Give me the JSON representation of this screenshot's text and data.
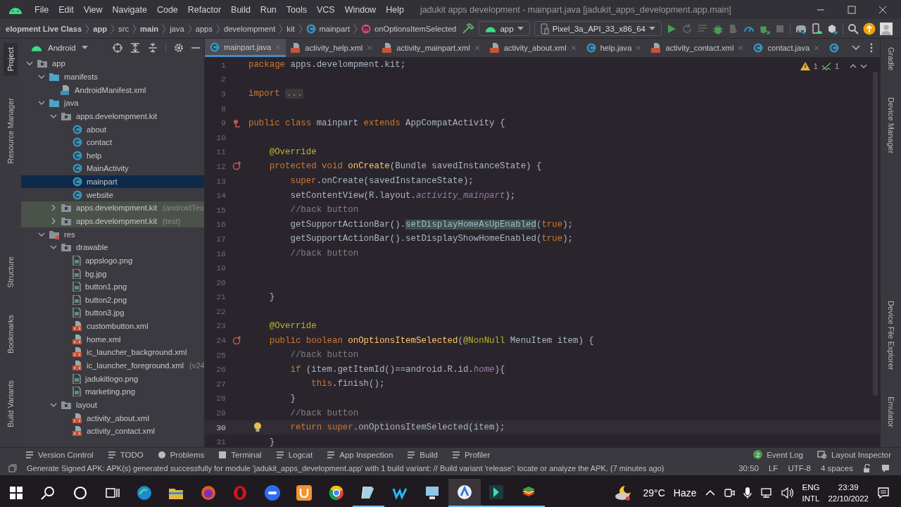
{
  "window": {
    "title": "jadukit apps development - mainpart.java [jadukit_apps_development.app.main]"
  },
  "menu": [
    "File",
    "Edit",
    "View",
    "Navigate",
    "Code",
    "Refactor",
    "Build",
    "Run",
    "Tools",
    "VCS",
    "Window",
    "Help"
  ],
  "breadcrumbs": [
    {
      "label": "elopment Live Class",
      "kind": "plain",
      "bold": true
    },
    {
      "label": "app",
      "kind": "plain",
      "bold": true
    },
    {
      "label": "src",
      "kind": "plain",
      "bold": false
    },
    {
      "label": "main",
      "kind": "plain",
      "bold": true
    },
    {
      "label": "java",
      "kind": "plain",
      "bold": false
    },
    {
      "label": "apps",
      "kind": "plain",
      "bold": false
    },
    {
      "label": "develompment",
      "kind": "plain",
      "bold": false
    },
    {
      "label": "kit",
      "kind": "plain",
      "bold": false
    },
    {
      "label": "mainpart",
      "kind": "class",
      "bold": false
    },
    {
      "label": "onOptionsItemSelected",
      "kind": "method",
      "bold": false
    }
  ],
  "run_config": {
    "module": "app",
    "device": "Pixel_3a_API_33_x86_64"
  },
  "run_tools": [
    {
      "disabled": false
    },
    {
      "disabled": true
    },
    {
      "disabled": true
    },
    {
      "disabled": false
    },
    {
      "disabled": true
    },
    {
      "disabled": false
    },
    {
      "disabled": false
    },
    {
      "disabled": true
    }
  ],
  "left_tools": [
    {
      "label": "Project",
      "selected": true
    },
    {
      "label": "Resource Manager",
      "selected": false
    },
    {
      "label": "Structure",
      "selected": false
    },
    {
      "label": "Bookmarks",
      "selected": false
    },
    {
      "label": "Build Variants",
      "selected": false
    }
  ],
  "right_tools": [
    {
      "label": "Gradle",
      "selected": false
    },
    {
      "label": "Device Manager",
      "selected": false
    },
    {
      "label": "Device File Explorer",
      "selected": false
    },
    {
      "label": "Emulator",
      "selected": false
    }
  ],
  "project": {
    "view": "Android",
    "tree": [
      {
        "label": "app",
        "kind": "module",
        "expanded": true,
        "selected": false,
        "children": [
          {
            "label": "manifests",
            "kind": "folder",
            "expanded": true,
            "selected": false,
            "children": [
              {
                "label": "AndroidManifest.xml",
                "kind": "manifest",
                "selected": false
              }
            ]
          },
          {
            "label": "java",
            "kind": "folder",
            "expanded": true,
            "selected": false,
            "children": [
              {
                "label": "apps.develompment.kit",
                "kind": "package",
                "expanded": true,
                "selected": false,
                "children": [
                  {
                    "label": "about",
                    "kind": "class",
                    "selected": false
                  },
                  {
                    "label": "contact",
                    "kind": "class",
                    "selected": false
                  },
                  {
                    "label": "help",
                    "kind": "class",
                    "selected": false
                  },
                  {
                    "label": "MainActivity",
                    "kind": "class",
                    "selected": false
                  },
                  {
                    "label": "mainpart",
                    "kind": "class",
                    "selected": true
                  },
                  {
                    "label": "website",
                    "kind": "class",
                    "selected": false
                  }
                ]
              },
              {
                "label": "apps.develompment.kit",
                "suffix": "(androidTes",
                "kind": "test-package",
                "expanded": false,
                "selected": false
              },
              {
                "label": "apps.develompment.kit",
                "suffix": "(test)",
                "kind": "test-package",
                "expanded": false,
                "selected": false
              }
            ]
          },
          {
            "label": "res",
            "kind": "res",
            "expanded": true,
            "selected": false,
            "children": [
              {
                "label": "drawable",
                "kind": "package",
                "expanded": true,
                "selected": false,
                "children": [
                  {
                    "label": "appslogo.png",
                    "kind": "image",
                    "selected": false
                  },
                  {
                    "label": "bg.jpg",
                    "kind": "image",
                    "selected": false
                  },
                  {
                    "label": "button1.png",
                    "kind": "image",
                    "selected": false
                  },
                  {
                    "label": "button2.png",
                    "kind": "image",
                    "selected": false
                  },
                  {
                    "label": "button3.jpg",
                    "kind": "image",
                    "selected": false
                  },
                  {
                    "label": "custombutton.xml",
                    "kind": "xml",
                    "selected": false
                  },
                  {
                    "label": "home.xml",
                    "kind": "xml",
                    "selected": false
                  },
                  {
                    "label": "ic_launcher_background.xml",
                    "kind": "xml",
                    "selected": false
                  },
                  {
                    "label": "ic_launcher_foreground.xml",
                    "suffix": "(v24",
                    "kind": "xml",
                    "selected": false
                  },
                  {
                    "label": "jadukitlogo.png",
                    "kind": "image",
                    "selected": false
                  },
                  {
                    "label": "marketing.png",
                    "kind": "image",
                    "selected": false
                  }
                ]
              },
              {
                "label": "layout",
                "kind": "package",
                "expanded": true,
                "selected": false,
                "children": [
                  {
                    "label": "activity_about.xml",
                    "kind": "xml",
                    "selected": false
                  },
                  {
                    "label": "activity_contact.xml",
                    "kind": "xml",
                    "selected": false
                  }
                ]
              }
            ]
          }
        ]
      }
    ]
  },
  "editor": {
    "tabs": [
      {
        "label": "mainpart.java",
        "kind": "java",
        "selected": true
      },
      {
        "label": "activity_help.xml",
        "kind": "xml",
        "selected": false
      },
      {
        "label": "activity_mainpart.xml",
        "kind": "xml",
        "selected": false
      },
      {
        "label": "activity_about.xml",
        "kind": "xml",
        "selected": false
      },
      {
        "label": "help.java",
        "kind": "java",
        "selected": false
      },
      {
        "label": "activity_contact.xml",
        "kind": "xml",
        "selected": false
      },
      {
        "label": "contact.java",
        "kind": "java",
        "selected": false
      },
      {
        "kind": "java",
        "selected": false
      }
    ],
    "warnings": "1",
    "typos": "1",
    "lines": [
      {
        "number": "1",
        "current": false,
        "tokens": [
          {
            "kind": "kw",
            "text": "package "
          },
          {
            "kind": "plain",
            "text": "apps.develompment.kit;"
          }
        ]
      },
      {
        "number": "2",
        "current": false
      },
      {
        "number": "3",
        "current": false,
        "tokens": [
          {
            "kind": "kw",
            "text": "import "
          },
          {
            "kind": "folded",
            "text": "..."
          }
        ]
      },
      {
        "number": "8",
        "current": false
      },
      {
        "number": "9",
        "current": false,
        "kind": "class",
        "tokens": [
          {
            "kind": "kw",
            "text": "public class "
          },
          {
            "kind": "plain",
            "text": "mainpart "
          },
          {
            "kind": "kw",
            "text": "extends "
          },
          {
            "kind": "plain",
            "text": "AppCompatActivity {"
          }
        ]
      },
      {
        "number": "10",
        "current": false
      },
      {
        "number": "11",
        "current": false,
        "tokens": [
          {
            "kind": "ann",
            "text": "    @Override"
          }
        ]
      },
      {
        "number": "12",
        "current": false,
        "kind": "override",
        "tokens": [
          {
            "kind": "kw",
            "text": "    protected void "
          },
          {
            "kind": "method",
            "text": "onCreate"
          },
          {
            "kind": "plain",
            "text": "(Bundle savedInstanceState) {"
          }
        ]
      },
      {
        "number": "13",
        "current": false,
        "tokens": [
          {
            "kind": "kw",
            "text": "        super"
          },
          {
            "kind": "plain",
            "text": ".onCreate(savedInstanceState);"
          }
        ]
      },
      {
        "number": "14",
        "current": false,
        "tokens": [
          {
            "kind": "plain",
            "text": "        setContentView(R.layout."
          },
          {
            "kind": "field",
            "text": "activity_mainpart"
          },
          {
            "kind": "plain",
            "text": ");"
          }
        ]
      },
      {
        "number": "15",
        "current": false,
        "tokens": [
          {
            "kind": "comment",
            "text": "        //back button"
          }
        ]
      },
      {
        "number": "16",
        "current": false,
        "tokens": [
          {
            "kind": "plain",
            "text": "        getSupportActionBar()."
          },
          {
            "kind": "match",
            "text": "setDisplayHomeAsUpEnabled"
          },
          {
            "kind": "plain",
            "text": "("
          },
          {
            "kind": "kw",
            "text": "true"
          },
          {
            "kind": "plain",
            "text": ");"
          }
        ]
      },
      {
        "number": "17",
        "current": false,
        "tokens": [
          {
            "kind": "plain",
            "text": "        getSupportActionBar().setDisplayShowHomeEnabled("
          },
          {
            "kind": "kw",
            "text": "true"
          },
          {
            "kind": "plain",
            "text": ");"
          }
        ]
      },
      {
        "number": "18",
        "current": false,
        "tokens": [
          {
            "kind": "comment",
            "text": "        //back button"
          }
        ]
      },
      {
        "number": "19",
        "current": false
      },
      {
        "number": "20",
        "current": false
      },
      {
        "number": "21",
        "current": false,
        "tokens": [
          {
            "kind": "plain",
            "text": "    }"
          }
        ]
      },
      {
        "number": "22",
        "current": false
      },
      {
        "number": "23",
        "current": false,
        "tokens": [
          {
            "kind": "ann",
            "text": "    @Override"
          }
        ]
      },
      {
        "number": "24",
        "current": false,
        "kind": "override",
        "tokens": [
          {
            "kind": "kw",
            "text": "    public boolean "
          },
          {
            "kind": "method",
            "text": "onOptionsItemSelected"
          },
          {
            "kind": "plain",
            "text": "("
          },
          {
            "kind": "ann",
            "text": "@NonNull "
          },
          {
            "kind": "plain",
            "text": "MenuItem item) {"
          }
        ]
      },
      {
        "number": "25",
        "current": false,
        "tokens": [
          {
            "kind": "comment",
            "text": "        //back button"
          }
        ]
      },
      {
        "number": "26",
        "current": false,
        "tokens": [
          {
            "kind": "kw",
            "text": "        if "
          },
          {
            "kind": "plain",
            "text": "(item.getItemId()==android.R.id."
          },
          {
            "kind": "field",
            "text": "home"
          },
          {
            "kind": "plain",
            "text": "){"
          }
        ]
      },
      {
        "number": "27",
        "current": false,
        "tokens": [
          {
            "kind": "kw",
            "text": "            this"
          },
          {
            "kind": "plain",
            "text": ".finish();"
          }
        ]
      },
      {
        "number": "28",
        "current": false,
        "tokens": [
          {
            "kind": "plain",
            "text": "        }"
          }
        ]
      },
      {
        "number": "29",
        "current": false,
        "tokens": [
          {
            "kind": "comment",
            "text": "        //back button"
          }
        ]
      },
      {
        "number": "30",
        "current": true,
        "kind": "bulb",
        "tokens": [
          {
            "kind": "kw",
            "text": "        return super"
          },
          {
            "kind": "plain",
            "text": ".onOptionsItemSelected(item);"
          }
        ]
      },
      {
        "number": "31",
        "current": false,
        "tokens": [
          {
            "kind": "plain",
            "text": "    }"
          }
        ]
      }
    ]
  },
  "tool_windows": [
    "Version Control",
    "TODO",
    "Problems",
    "Terminal",
    "Logcat",
    "App Inspection",
    "Build",
    "Profiler"
  ],
  "tool_windows_right": [
    {
      "label": "Event Log",
      "badge": "2"
    },
    {
      "label": "Layout Inspector"
    }
  ],
  "status_bar": {
    "message": "Generate Signed APK: APK(s) generated successfully for module 'jadukit_apps_development.app' with 1 build variant: // Build variant 'release': locate or analyze the APK. (7 minutes ago)",
    "position": "30:50",
    "line_separator": "LF",
    "encoding": "UTF-8",
    "indent": "4 spaces"
  },
  "taskbar": {
    "apps": [
      {
        "running": false,
        "selected": false
      },
      {
        "running": false,
        "selected": false
      },
      {
        "running": false,
        "selected": false
      },
      {
        "running": false,
        "selected": false
      },
      {
        "running": false,
        "selected": false
      },
      {
        "running": false,
        "selected": false
      },
      {
        "running": false,
        "selected": false
      },
      {
        "running": false,
        "selected": false
      },
      {
        "running": false,
        "selected": false
      },
      {
        "running": false,
        "selected": false
      },
      {
        "running": false,
        "selected": false
      },
      {
        "running": true,
        "selected": false
      },
      {
        "running": false,
        "selected": false
      },
      {
        "running": false,
        "selected": false
      },
      {
        "running": true,
        "selected": true
      },
      {
        "running": true,
        "selected": false
      },
      {
        "running": true,
        "selected": false
      }
    ],
    "temperature": "29°C",
    "weather": "Haze",
    "language": "ENG",
    "layout": "INTL",
    "time": "23:39",
    "date": "22/10/2022"
  }
}
